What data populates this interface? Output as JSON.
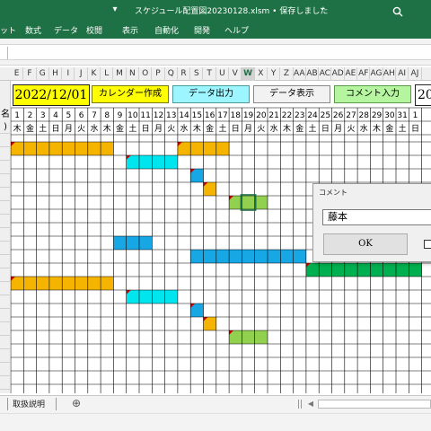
{
  "window": {
    "title": "スケジュール配置図20230128.xlsm • 保存しました",
    "title_chevron": "⌄",
    "search_icon": "search-icon",
    "accent": "#1e7145"
  },
  "ribbon": {
    "tabs": [
      "ット",
      "数式",
      "データ",
      "校閲",
      "表示",
      "自動化",
      "開発",
      "ヘルプ"
    ]
  },
  "columns": [
    "E",
    "F",
    "G",
    "H",
    "I",
    "J",
    "K",
    "L",
    "M",
    "N",
    "O",
    "P",
    "Q",
    "R",
    "S",
    "T",
    "U",
    "V",
    "W",
    "X",
    "Y",
    "Z",
    "AA",
    "AB",
    "AC",
    "AD",
    "AE",
    "AF",
    "AG",
    "AH",
    "AI",
    "AJ"
  ],
  "selected_column": "W",
  "sheet": {
    "date_cell": "2022/12/01",
    "right_partial": "20",
    "name_header_partial": "名",
    "name_header_partial2": ")",
    "day_numbers": [
      "1",
      "2",
      "3",
      "4",
      "5",
      "6",
      "7",
      "8",
      "9",
      "10",
      "11",
      "12",
      "13",
      "14",
      "15",
      "16",
      "17",
      "18",
      "19",
      "20",
      "21",
      "22",
      "23",
      "24",
      "25",
      "26",
      "27",
      "28",
      "29",
      "30",
      "31",
      "1"
    ],
    "weekdays": [
      "木",
      "金",
      "土",
      "日",
      "月",
      "火",
      "水",
      "木",
      "金",
      "土",
      "日",
      "月",
      "火",
      "水",
      "木",
      "金",
      "土",
      "日",
      "月",
      "火",
      "水",
      "木",
      "金",
      "土",
      "日",
      "月",
      "火",
      "水",
      "木",
      "金",
      "土",
      "日"
    ]
  },
  "buttons": {
    "calendar": "カレンダー作成",
    "data_output": "データ出力",
    "data_display": "データ表示",
    "comment_input": "コメント入力"
  },
  "colors": {
    "orange": "#f5b400",
    "cyan": "#00e5ee",
    "blue": "#16a7e4",
    "green_light": "#92d050",
    "green": "#00b050",
    "date_bg": "#ffff00",
    "calendar_btn": "#ffff00",
    "data_output_btn": "#9cf5ff",
    "data_display_btn": "#f2f2f2",
    "comment_btn": "#b6f5a0",
    "comment_marker": "#d00000"
  },
  "dialog": {
    "title": "コメント",
    "input_value": "藤本",
    "ok_label": "OK"
  },
  "bottom": {
    "sheet_tab": "取扱説明",
    "add_sheet": "⊕",
    "scroll_left": "◀",
    "scroll_right": "▶"
  }
}
